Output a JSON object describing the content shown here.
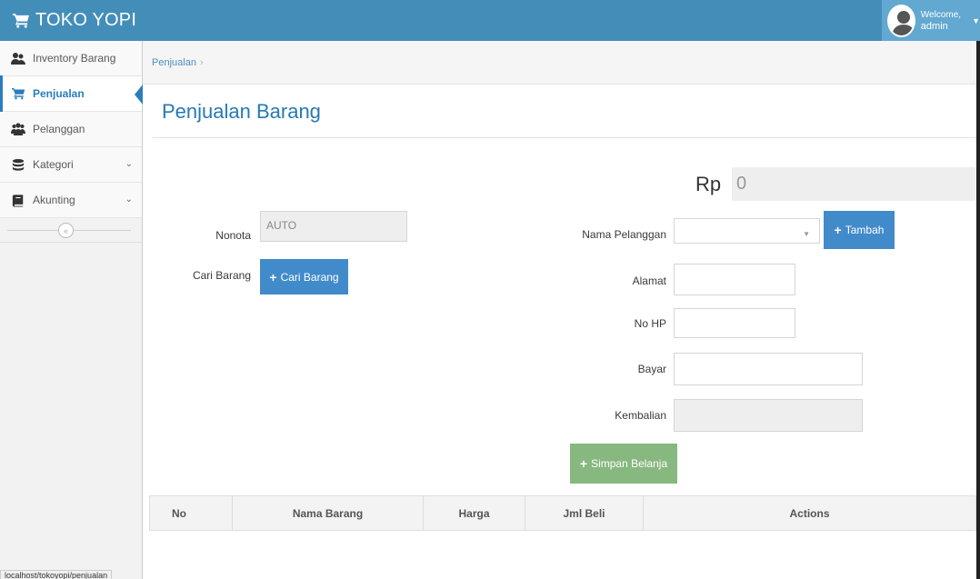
{
  "navbar": {
    "brand": "TOKO YOPI",
    "welcome": "Welcome,",
    "username": "admin"
  },
  "sidebar": {
    "items": [
      {
        "label": "Inventory Barang",
        "icon": "users-icon"
      },
      {
        "label": "Penjualan",
        "icon": "cart-icon",
        "active": true
      },
      {
        "label": "Pelanggan",
        "icon": "group-icon"
      },
      {
        "label": "Kategori",
        "icon": "database-icon",
        "has_submenu": true
      },
      {
        "label": "Akunting",
        "icon": "book-icon",
        "has_submenu": true
      }
    ]
  },
  "breadcrumb": {
    "current": "Penjualan"
  },
  "page": {
    "title": "Penjualan Barang"
  },
  "total": {
    "currency": "Rp",
    "value": "0"
  },
  "form": {
    "nonota_label": "Nonota",
    "nonota_value": "AUTO",
    "cari_label": "Cari Barang",
    "cari_button": "Cari Barang",
    "pelanggan_label": "Nama Pelanggan",
    "pelanggan_value": "",
    "tambah_button": "Tambah",
    "alamat_label": "Alamat",
    "nohp_label": "No HP",
    "bayar_label": "Bayar",
    "kembalian_label": "Kembalian",
    "simpan_button": "Simpan Belanja"
  },
  "table": {
    "columns": [
      "No",
      "Nama Barang",
      "Harga",
      "Jml Beli",
      "Actions"
    ]
  },
  "status": {
    "url": "localhost/tokoyopi/penjualan"
  },
  "colors": {
    "navbar": "#438eb9",
    "primary": "#428bca",
    "success": "#87b87f",
    "title": "#2679b5"
  }
}
